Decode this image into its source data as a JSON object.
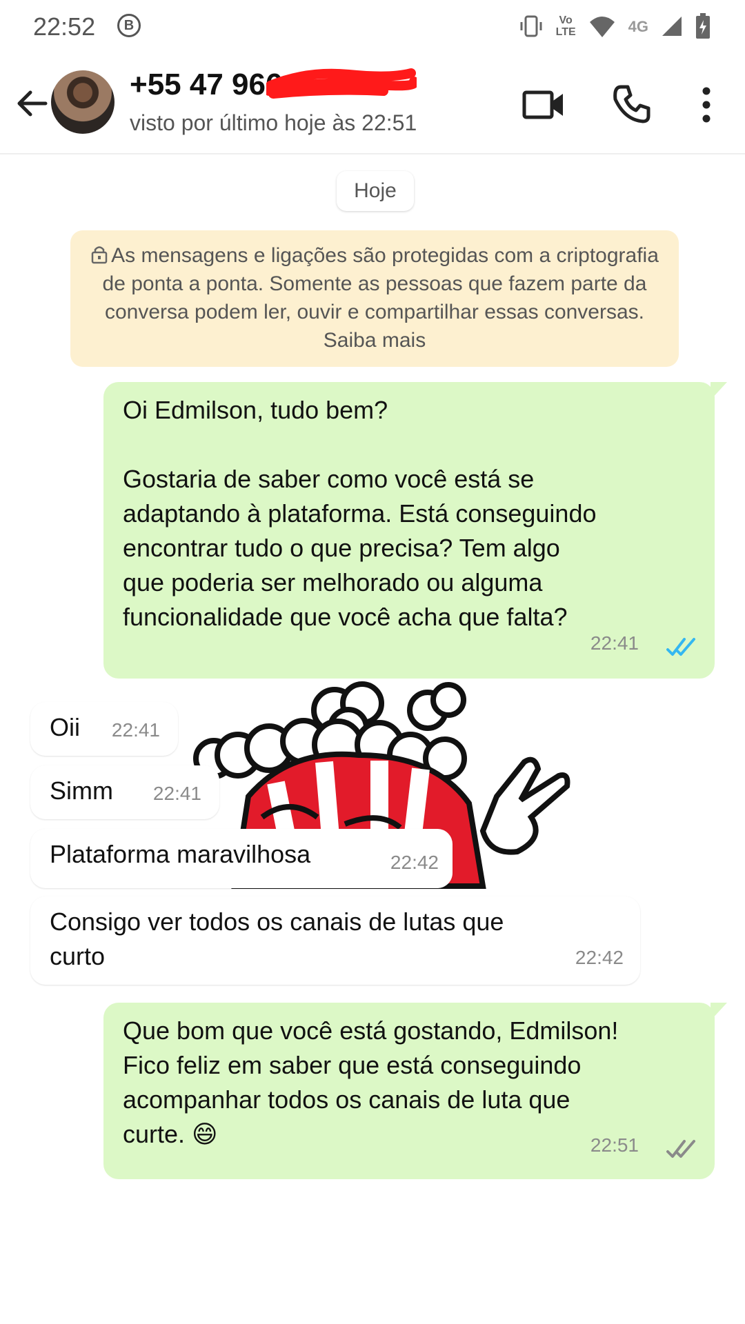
{
  "status_bar": {
    "time": "22:52",
    "b_icon": "B",
    "network_label_top": "Vo",
    "network_label_bottom": "LTE",
    "signal_label": "4G"
  },
  "header": {
    "contact_name": "+55 47 966",
    "last_seen": "visto por último hoje às 22:51"
  },
  "chat": {
    "date_label": "Hoje",
    "encryption_notice": "As mensagens e ligações são protegidas com a criptografia de ponta a ponta. Somente as pessoas que fazem parte da conversa podem ler, ouvir e compartilhar essas conversas. Saiba mais",
    "messages": [
      {
        "direction": "out",
        "text": "Oi Edmilson, tudo bem?\n\nGostaria de saber como você está se\nadaptando à plataforma. Está conseguindo\nencontrar tudo o que precisa? Tem algo\nque poderia ser melhorado ou alguma\nfuncionalidade que você acha que falta?",
        "time": "22:41",
        "status": "read"
      },
      {
        "direction": "in",
        "text": "Oii",
        "time": "22:41"
      },
      {
        "direction": "in",
        "text": "Simm",
        "time": "22:41"
      },
      {
        "direction": "in",
        "text": "Plataforma maravilhosa",
        "time": "22:42"
      },
      {
        "direction": "in",
        "text": "Consigo ver todos os canais de lutas que\ncurto",
        "time": "22:42"
      },
      {
        "direction": "out",
        "text": "Que bom que você está gostando, Edmilson!\nFico feliz em saber que está conseguindo\nacompanhar todos os canais de luta que\ncurte. 😄",
        "time": "22:51",
        "status": "delivered"
      }
    ]
  },
  "colors": {
    "outgoing_bubble": "#dcf8c6",
    "incoming_bubble": "#ffffff",
    "notice_bg": "#fdf0d0",
    "read_ticks": "#34b7f1",
    "delivered_ticks": "#8a8a8a"
  },
  "icons": [
    "back-arrow-icon",
    "video-call-icon",
    "phone-icon",
    "more-vert-icon",
    "lock-icon",
    "vibrate-icon",
    "wifi-icon",
    "signal-icon",
    "battery-icon"
  ]
}
